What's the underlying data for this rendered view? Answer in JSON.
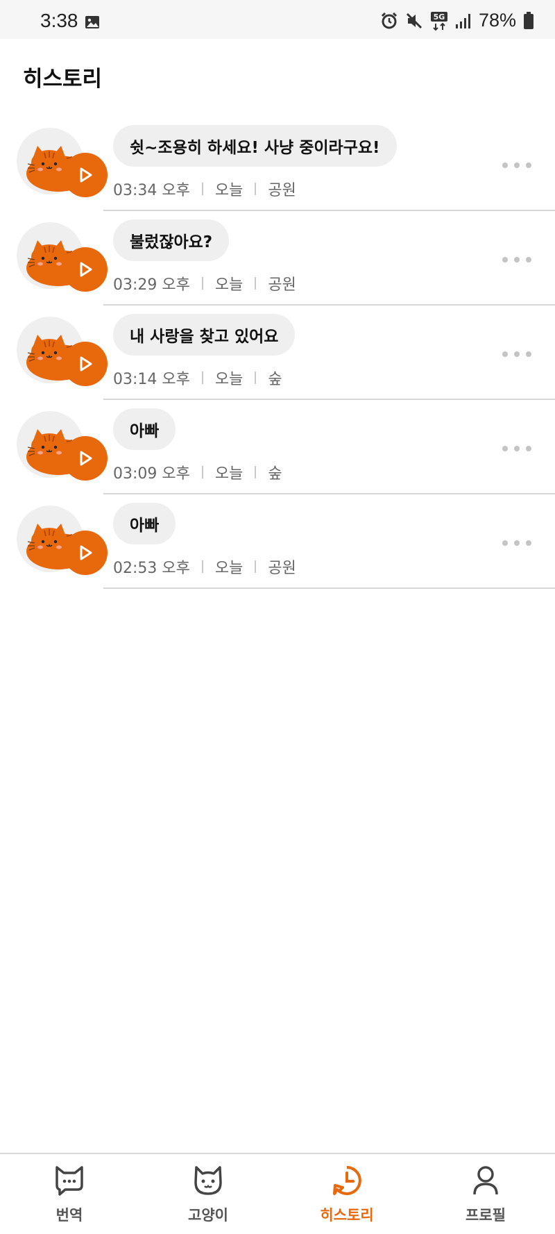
{
  "status_bar": {
    "time": "3:38",
    "battery": "78%",
    "icons": [
      "image-icon",
      "alarm-icon",
      "mute-icon",
      "5g-icon",
      "signal-icon",
      "battery-icon"
    ]
  },
  "page": {
    "title": "히스토리"
  },
  "colors": {
    "accent": "#e8680c",
    "bubble": "#efefef",
    "divider": "#d6d6d6"
  },
  "history": [
    {
      "message": "쉿~조용히 하세요! 사냥 중이라구요!",
      "time": "03:34 오후",
      "day": "오늘",
      "place": "공원"
    },
    {
      "message": "불렀잖아요?",
      "time": "03:29 오후",
      "day": "오늘",
      "place": "공원"
    },
    {
      "message": "내 사랑을 찾고 있어요",
      "time": "03:14 오후",
      "day": "오늘",
      "place": "숲"
    },
    {
      "message": "아빠",
      "time": "03:09 오후",
      "day": "오늘",
      "place": "숲"
    },
    {
      "message": "아빠",
      "time": "02:53 오후",
      "day": "오늘",
      "place": "공원"
    }
  ],
  "nav": {
    "active": "history",
    "items": [
      {
        "id": "translate",
        "label": "번역",
        "icon": "chat-cat-icon"
      },
      {
        "id": "cat",
        "label": "고양이",
        "icon": "cat-face-icon"
      },
      {
        "id": "history",
        "label": "히스토리",
        "icon": "clock-icon"
      },
      {
        "id": "profile",
        "label": "프로필",
        "icon": "person-icon"
      }
    ]
  }
}
